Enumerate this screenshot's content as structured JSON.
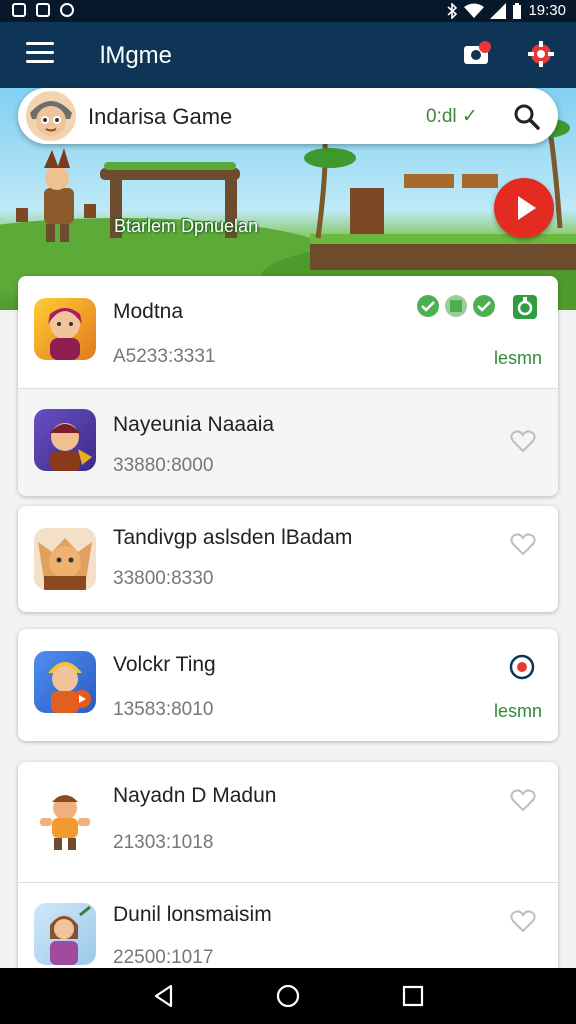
{
  "status_bar": {
    "time": "19:30",
    "icons_left": [
      "image-icon",
      "image-icon",
      "sync-icon"
    ],
    "icons_right": [
      "bluetooth-icon",
      "wifi-icon",
      "signal-icon",
      "battery-icon"
    ]
  },
  "app_bar": {
    "title": "lMgme",
    "actions": [
      "camera-icon",
      "gear-icon"
    ]
  },
  "search": {
    "title": "Indarisa Game",
    "status": "0:dl ✓",
    "search_icon": "search-icon"
  },
  "banner": {
    "label": "Btarlem Dpnuelan",
    "play_icon": "play-icon"
  },
  "games": [
    {
      "name": "Modtna",
      "code": "A5233:3331",
      "link": "lesmn",
      "badges": [
        "check-icon",
        "check-icon",
        "check-icon",
        "android-icon"
      ]
    },
    {
      "name": "Nayeunia Naaaia",
      "code": "33880:8000",
      "action_icon": "heart-outline-icon"
    },
    {
      "name": "Tandivgp aslsden lBadam",
      "code": "33800:8330",
      "action_icon": "heart-outline-icon"
    },
    {
      "name": "Volckr Ting",
      "code": "13583:8010",
      "link": "lesmn",
      "action_icon": "record-icon"
    },
    {
      "name": "Nayadn D Madun",
      "code": "21303:1018",
      "action_icon": "heart-outline-icon"
    },
    {
      "name": "Dunil lonsmaisim",
      "code": "22500:1017",
      "action_icon": "heart-outline-icon"
    }
  ],
  "nav": {
    "back_icon": "back-icon",
    "home_icon": "home-icon",
    "recents_icon": "recents-icon"
  },
  "colors": {
    "app_bar": "#0e3556",
    "status_bar": "#061829",
    "accent_green": "#2e8b3a",
    "play_red": "#e42b22"
  }
}
